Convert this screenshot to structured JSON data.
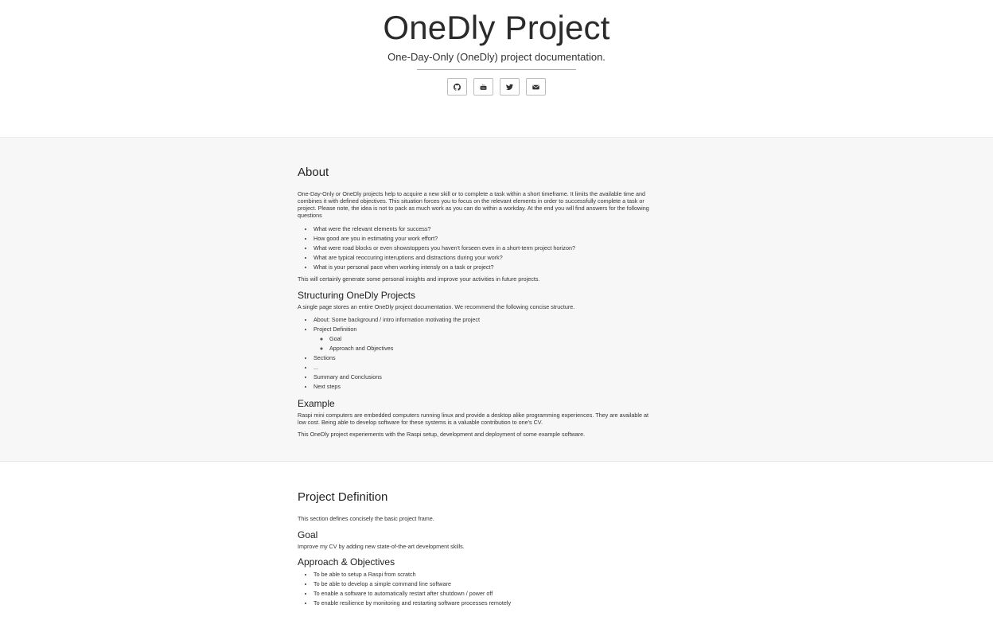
{
  "header": {
    "title": "OneDly Project",
    "subtitle": "One-Day-Only (OneDly) project documentation.",
    "social": [
      {
        "icon": "github-icon"
      },
      {
        "icon": "youtube-icon"
      },
      {
        "icon": "twitter-icon"
      },
      {
        "icon": "envelope-icon"
      }
    ]
  },
  "about": {
    "heading": "About",
    "intro": "One-Day-Only or OneDly projects help to acquire a new skill or to complete a task within a short timeframe. It limits the available time and combines it with defined objectives. This situation forces you to focus on the relevant elements in order to successfully complete a task or project. Please note, the idea is not to pack as much work as you can do within a workday. At the end you will find answers for the following questions",
    "questions": [
      "What were the relevant elements for success?",
      "How good are you in estimating your work effort?",
      "What were road blocks or even showstoppers you haven't forseen even in a short-term project horizon?",
      "What are typical reoccuring interuptions and distractions during your work?",
      "What is your personal pace when working intensly on a task or project?"
    ],
    "closing": "This will certainly generate some personal insights and improve your activities in future projects.",
    "structuring": {
      "heading": "Structuring OneDly Projects",
      "text": "A single page stores an entire OneDly project documentation. We recommend the following concise structure.",
      "items": [
        "About: Some background / intro information motivating the project",
        "Project Definition",
        "Sections",
        "...",
        "Summary and Conclusions",
        "Next steps"
      ],
      "subitems": [
        "Goal",
        "Approach and Objectives"
      ]
    },
    "example": {
      "heading": "Example",
      "text1": "Raspi mini computers are embedded computers running linux and provide a desktop alike programming experiences. They are available at low cost. Being able to develop software for these systems is a valuable contribution to one's CV.",
      "text2": "This OneDly project experiements with the Raspi setup, development and deployment of some example software."
    }
  },
  "project_definition": {
    "heading": "Project Definition",
    "intro": "This section defines concisely the basic project frame.",
    "goal": {
      "heading": "Goal",
      "text": "Improve my CV by adding new state-of-the-art development skills."
    },
    "approach": {
      "heading": "Approach & Objectives",
      "items": [
        "To be able to setup a Raspi from scratch",
        "To be able to develop a simple command line software",
        "To enable a software to automatically restart after shutdown / power off",
        "To enable resilience by monitoring and restarting software processes remotely"
      ]
    }
  }
}
